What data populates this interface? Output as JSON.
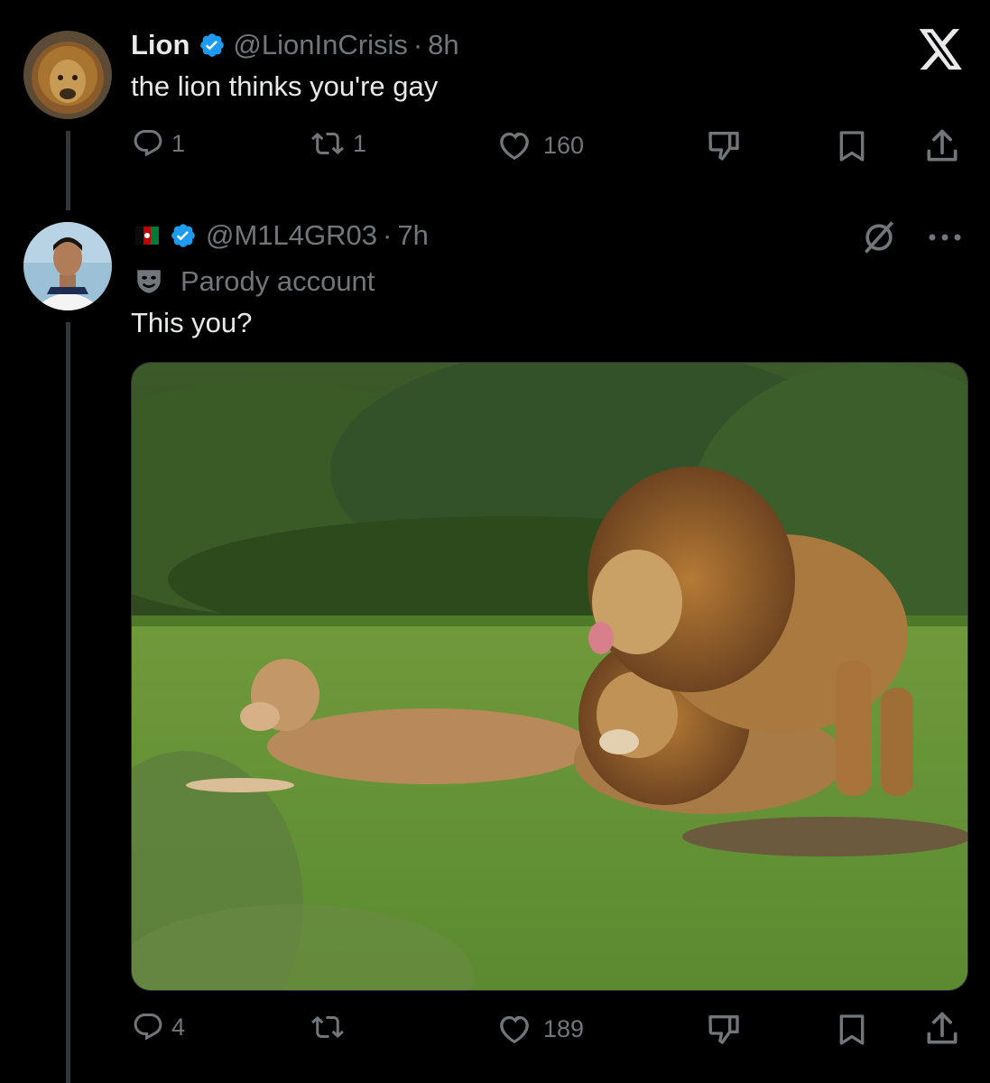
{
  "tweet1": {
    "name": "Lion",
    "handle": "@LionInCrisis",
    "sep": "·",
    "time": "8h",
    "text": "the lion thinks you're gay",
    "stats": {
      "replies": "1",
      "reposts": "1",
      "likes": "160"
    }
  },
  "tweet2": {
    "handle": "@M1L4GR03",
    "sep": "·",
    "time": "7h",
    "parody_label": "Parody account",
    "text": "This you?",
    "stats": {
      "replies": "4",
      "likes": "189"
    }
  },
  "colors": {
    "background": "#000000",
    "text": "#e7e9ea",
    "muted": "#71767b",
    "verified": "#1d9bf0",
    "thread_line": "#333639"
  },
  "icons": [
    "x-logo-icon",
    "verified-badge-icon",
    "reply-icon",
    "repost-icon",
    "like-icon",
    "dislike-icon",
    "bookmark-icon",
    "share-icon",
    "grok-icon",
    "more-icon",
    "parody-mask-icon",
    "flag-icon"
  ]
}
